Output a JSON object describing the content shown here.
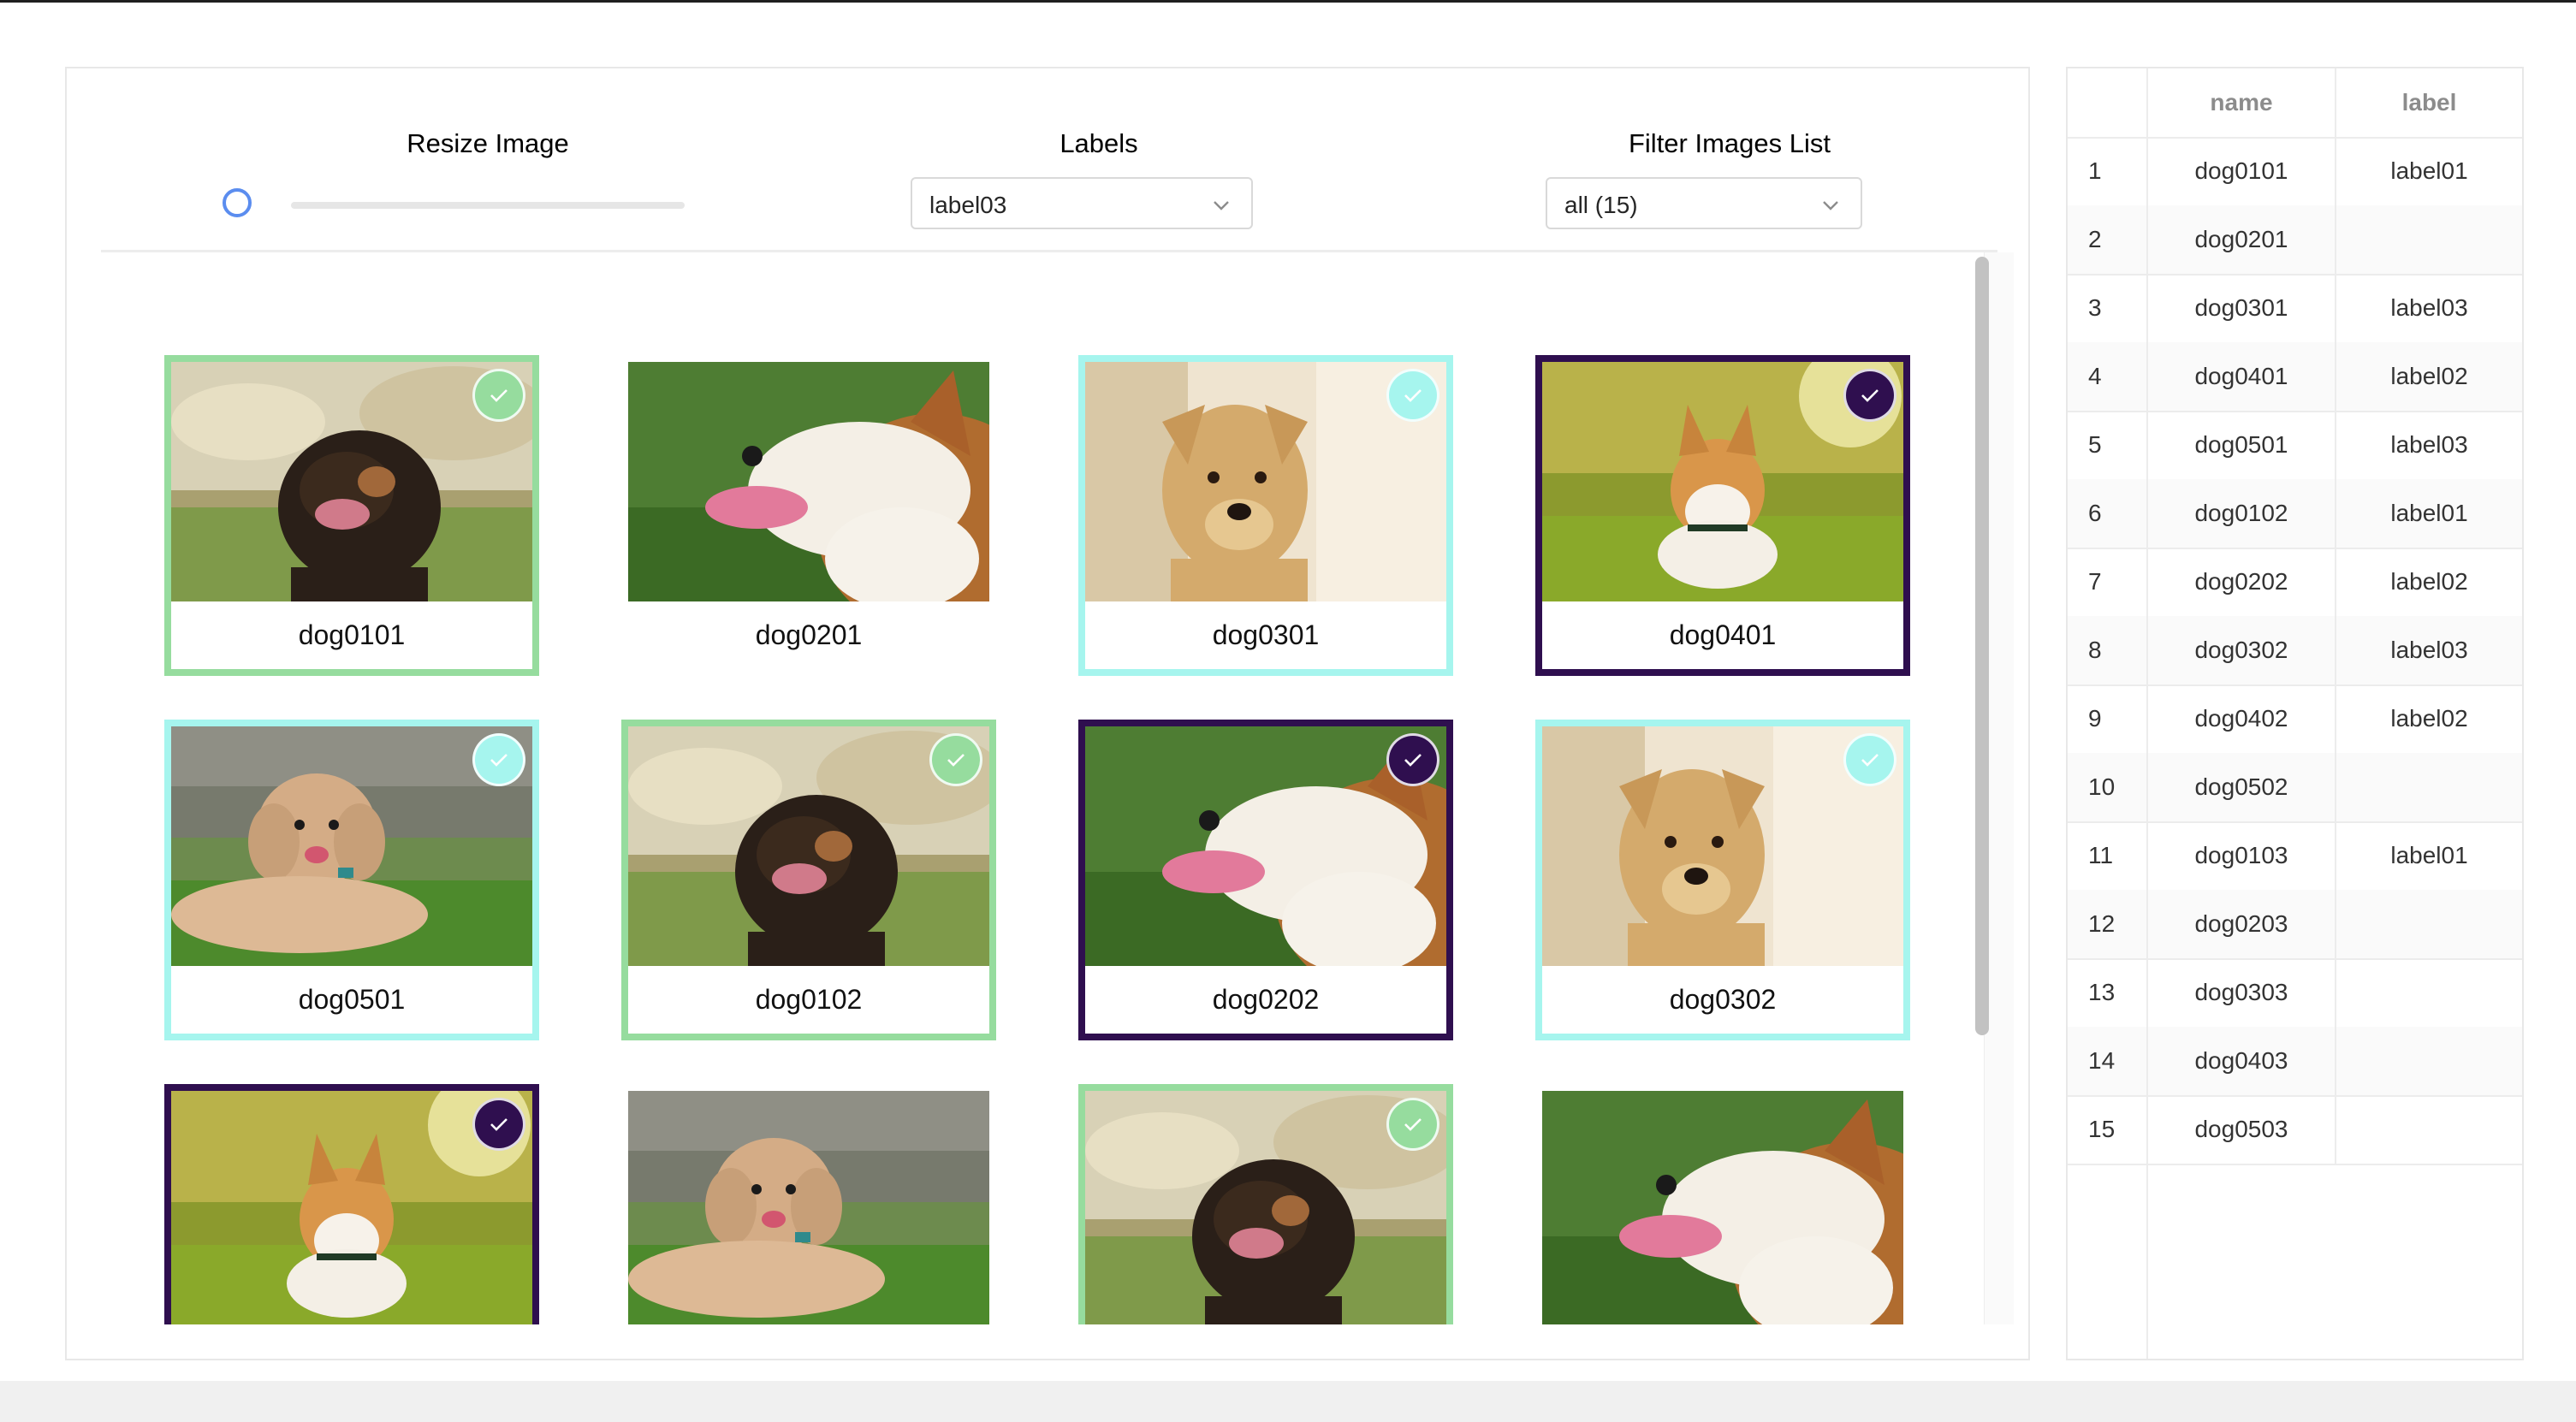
{
  "controls": {
    "resize_label": "Resize Image",
    "resize_value_fraction": 0.0,
    "labels_label": "Labels",
    "labels_selected": "label03",
    "filter_label": "Filter Images List",
    "filter_selected": "all (15)"
  },
  "colors": {
    "label01": "#96dc9e",
    "label02": "#2f0f4f",
    "label03": "#a6f5ee",
    "accent": "#5b8def"
  },
  "gallery": [
    {
      "name": "dog0101",
      "label": "label01",
      "photo": "puppy-black-tan"
    },
    {
      "name": "dog0201",
      "label": "",
      "photo": "corgi-tongue"
    },
    {
      "name": "dog0301",
      "label": "label03",
      "photo": "golden-dog"
    },
    {
      "name": "dog0401",
      "label": "label02",
      "photo": "corgi-grass"
    },
    {
      "name": "dog0501",
      "label": "label03",
      "photo": "poodle-lying"
    },
    {
      "name": "dog0102",
      "label": "label01",
      "photo": "puppy-black-tan"
    },
    {
      "name": "dog0202",
      "label": "label02",
      "photo": "corgi-tongue"
    },
    {
      "name": "dog0302",
      "label": "label03",
      "photo": "golden-dog"
    },
    {
      "name": "dog0402",
      "label": "label02",
      "photo": "corgi-grass"
    },
    {
      "name": "dog0502",
      "label": "",
      "photo": "poodle-lying"
    },
    {
      "name": "dog0103",
      "label": "label01",
      "photo": "puppy-black-tan"
    },
    {
      "name": "dog0203",
      "label": "",
      "photo": "corgi-tongue"
    }
  ],
  "table": {
    "headers": [
      "",
      "name",
      "label"
    ],
    "rows": [
      [
        "1",
        "dog0101",
        "label01"
      ],
      [
        "2",
        "dog0201",
        ""
      ],
      [
        "3",
        "dog0301",
        "label03"
      ],
      [
        "4",
        "dog0401",
        "label02"
      ],
      [
        "5",
        "dog0501",
        "label03"
      ],
      [
        "6",
        "dog0102",
        "label01"
      ],
      [
        "7",
        "dog0202",
        "label02"
      ],
      [
        "8",
        "dog0302",
        "label03"
      ],
      [
        "9",
        "dog0402",
        "label02"
      ],
      [
        "10",
        "dog0502",
        ""
      ],
      [
        "11",
        "dog0103",
        "label01"
      ],
      [
        "12",
        "dog0203",
        ""
      ],
      [
        "13",
        "dog0303",
        ""
      ],
      [
        "14",
        "dog0403",
        ""
      ],
      [
        "15",
        "dog0503",
        ""
      ]
    ]
  }
}
